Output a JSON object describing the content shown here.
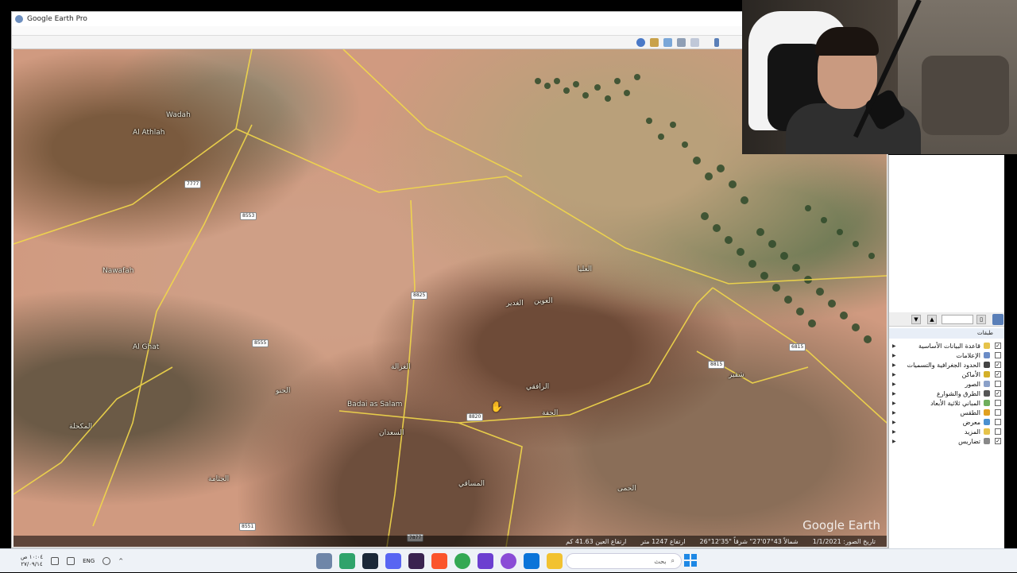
{
  "window": {
    "title": "Google Earth Pro"
  },
  "map": {
    "place_labels": [
      {
        "text": "Al Athlah",
        "pos": "a"
      },
      {
        "text": "Wadah",
        "pos": "b"
      },
      {
        "text": "Nawafah",
        "pos": "c"
      },
      {
        "text": "Al Ghat",
        "pos": "d"
      },
      {
        "text": "Badai as Salam",
        "pos": "e"
      },
      {
        "text": "العوين",
        "pos": "f"
      },
      {
        "text": "الجفة",
        "pos": "g"
      },
      {
        "text": "الرافقي",
        "pos": "h"
      },
      {
        "text": "السعدان",
        "pos": "i"
      },
      {
        "text": "المساقي",
        "pos": "j"
      },
      {
        "text": "العليا",
        "pos": "k"
      },
      {
        "text": "الغدير",
        "pos": "l"
      },
      {
        "text": "الغزالة",
        "pos": "m"
      },
      {
        "text": "الجثامة",
        "pos": "n"
      },
      {
        "text": "الحنو",
        "pos": "o"
      },
      {
        "text": "شقير",
        "pos": "p"
      },
      {
        "text": "المكحلة",
        "pos": "q"
      },
      {
        "text": "الحمى",
        "pos": "r"
      }
    ],
    "road_shields": [
      "7777",
      "8553",
      "8825",
      "8555",
      "8820",
      "8551",
      "7877",
      "8815",
      "6815"
    ],
    "watermark": "Google Earth",
    "status": {
      "imagery_date": "تاريخ الصور: 1/1/2021",
      "coords": "26°12'35\" شمالاً 43°07'27\" شرقاً",
      "elevation": "ارتفاع 1247 متر",
      "eye_alt": "ارتفاع العين 41.63 كم"
    }
  },
  "layers_panel": {
    "header": "طبقات",
    "items": [
      {
        "label": "قاعدة البيانات الأساسية",
        "checked": true,
        "icon_color": "#e6c34a"
      },
      {
        "label": "الإعلامات",
        "checked": false,
        "icon_color": "#6b8cc7"
      },
      {
        "label": "الحدود الجغرافية والتسميات",
        "checked": true,
        "icon_color": "#444444"
      },
      {
        "label": "الأماكن",
        "checked": true,
        "icon_color": "#d4b028"
      },
      {
        "label": "الصور",
        "checked": false,
        "icon_color": "#8aa0c8"
      },
      {
        "label": "الطرق والشوارع",
        "checked": true,
        "icon_color": "#555555"
      },
      {
        "label": "المباني ثلاثية الأبعاد",
        "checked": false,
        "icon_color": "#6fae5c"
      },
      {
        "label": "الطقس",
        "checked": false,
        "icon_color": "#e0a020"
      },
      {
        "label": "معرض",
        "checked": false,
        "icon_color": "#4a90d0"
      },
      {
        "label": "المزيد",
        "checked": false,
        "icon_color": "#e6c34a"
      },
      {
        "label": "تضاريس",
        "checked": true,
        "icon_color": "#888888"
      }
    ]
  },
  "taskbar": {
    "time": "١٠:٠٤ ص",
    "date": "٢٧/٠٩/١٤",
    "language": "ENG",
    "search_placeholder": "بحث"
  }
}
